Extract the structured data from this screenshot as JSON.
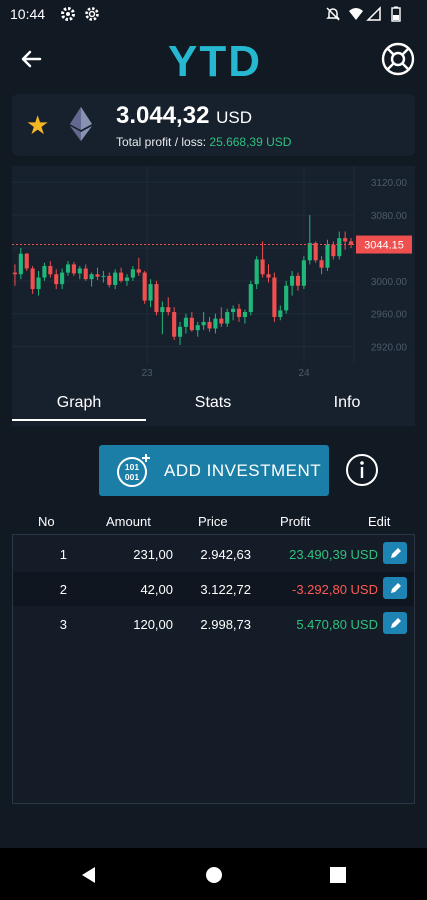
{
  "status": {
    "time": "10:44"
  },
  "app": {
    "logo": "YTD"
  },
  "asset": {
    "icon": "ethereum-icon",
    "price": "3.044,32",
    "currency": "USD",
    "profit_label": "Total profit / loss:",
    "profit_value": "25.668,39 USD"
  },
  "chart_data": {
    "type": "candlestick",
    "y_ticks": [
      "3120.00",
      "3080.00",
      "3040.00",
      "3000.00",
      "2960.00",
      "2920.00"
    ],
    "x_ticks": [
      "23",
      "24"
    ],
    "current_price_label": "3044.15",
    "ylim": [
      2900,
      3130
    ],
    "candles": [
      [
        3010,
        3020,
        2994,
        3008
      ],
      [
        3008,
        3040,
        3002,
        3033
      ],
      [
        3033,
        3034,
        3012,
        3015
      ],
      [
        3015,
        3018,
        2984,
        2990
      ],
      [
        2990,
        3012,
        2982,
        3004
      ],
      [
        3004,
        3022,
        3000,
        3018
      ],
      [
        3018,
        3024,
        3004,
        3008
      ],
      [
        3008,
        3014,
        2990,
        2996
      ],
      [
        2996,
        3015,
        2990,
        3010
      ],
      [
        3010,
        3024,
        3006,
        3020
      ],
      [
        3020,
        3023,
        3006,
        3009
      ],
      [
        3009,
        3018,
        3002,
        3015
      ],
      [
        3015,
        3020,
        3000,
        3002
      ],
      [
        3002,
        3010,
        2993,
        3008
      ],
      [
        3008,
        3016,
        3001,
        3005
      ],
      [
        3005,
        3012,
        2998,
        3006
      ],
      [
        3006,
        3010,
        2992,
        2995
      ],
      [
        2995,
        3014,
        2990,
        3010
      ],
      [
        3010,
        3016,
        2998,
        3000
      ],
      [
        3000,
        3008,
        2994,
        3004
      ],
      [
        3004,
        3018,
        3000,
        3014
      ],
      [
        3014,
        3028,
        3006,
        3010
      ],
      [
        3010,
        3012,
        2972,
        2976
      ],
      [
        2976,
        3002,
        2968,
        2996
      ],
      [
        2996,
        3000,
        2958,
        2962
      ],
      [
        2962,
        2975,
        2935,
        2968
      ],
      [
        2968,
        2980,
        2958,
        2962
      ],
      [
        2962,
        2968,
        2928,
        2932
      ],
      [
        2932,
        2950,
        2922,
        2944
      ],
      [
        2944,
        2960,
        2936,
        2955
      ],
      [
        2955,
        2962,
        2938,
        2940
      ],
      [
        2940,
        2950,
        2932,
        2946
      ],
      [
        2946,
        2962,
        2940,
        2950
      ],
      [
        2950,
        2956,
        2938,
        2942
      ],
      [
        2942,
        2960,
        2936,
        2954
      ],
      [
        2954,
        2968,
        2944,
        2948
      ],
      [
        2948,
        2966,
        2944,
        2962
      ],
      [
        2962,
        2970,
        2952,
        2966
      ],
      [
        2966,
        2972,
        2950,
        2956
      ],
      [
        2956,
        2965,
        2948,
        2962
      ],
      [
        2962,
        3000,
        2958,
        2996
      ],
      [
        2996,
        3030,
        2990,
        3026
      ],
      [
        3026,
        3048,
        3004,
        3008
      ],
      [
        3008,
        3020,
        2998,
        3004
      ],
      [
        3004,
        3010,
        2950,
        2956
      ],
      [
        2956,
        2970,
        2952,
        2964
      ],
      [
        2964,
        3000,
        2960,
        2994
      ],
      [
        2994,
        3012,
        2982,
        3006
      ],
      [
        3006,
        3010,
        2988,
        2994
      ],
      [
        2994,
        3030,
        2990,
        3025
      ],
      [
        3025,
        3080,
        3020,
        3046
      ],
      [
        3046,
        3048,
        3022,
        3025
      ],
      [
        3025,
        3030,
        3008,
        3016
      ],
      [
        3016,
        3050,
        3012,
        3044
      ],
      [
        3044,
        3048,
        3026,
        3030
      ],
      [
        3030,
        3060,
        3026,
        3052
      ],
      [
        3052,
        3060,
        3038,
        3048
      ],
      [
        3048,
        3052,
        3040,
        3044
      ]
    ]
  },
  "tabs": [
    "Graph",
    "Stats",
    "Info"
  ],
  "add_button": {
    "icon_text_top": "101",
    "icon_text_bottom": "001",
    "label": "ADD INVESTMENT"
  },
  "table": {
    "headers": [
      "No",
      "Amount",
      "Price",
      "Profit",
      "Edit"
    ],
    "rows": [
      {
        "no": "1",
        "amount": "231,00",
        "price": "2.942,63",
        "profit": "23.490,39 USD",
        "positive": true
      },
      {
        "no": "2",
        "amount": "42,00",
        "price": "3.122,72",
        "profit": "-3.292,80 USD",
        "positive": false
      },
      {
        "no": "3",
        "amount": "120,00",
        "price": "2.998,73",
        "profit": "5.470,80 USD",
        "positive": true
      }
    ]
  },
  "colors": {
    "up": "#1fb87a",
    "down": "#ef4f4f",
    "accent": "#1b7ea6",
    "logo": "#25b8d0"
  }
}
